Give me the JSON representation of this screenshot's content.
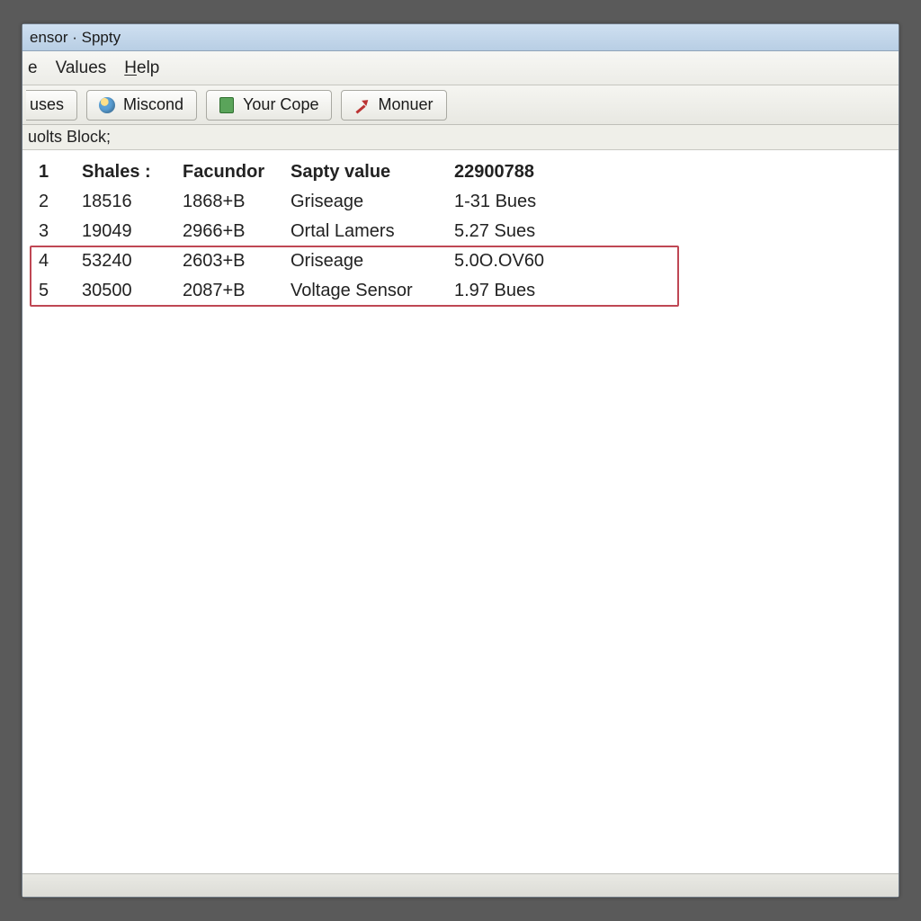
{
  "window": {
    "title": "ensor · Sppty"
  },
  "menubar": {
    "item0": "e",
    "item1": "Values",
    "item2_prefix": "H",
    "item2_rest": "elp"
  },
  "toolbar": {
    "btn0": "uses",
    "btn1": "Miscond",
    "btn2": "Your Cope",
    "btn3": "Monuer"
  },
  "subbar": {
    "text": "uolts Block;"
  },
  "table": {
    "header": {
      "c0": "1",
      "c1": "Shales :",
      "c2": "Facundor",
      "c3": "Sapty value",
      "c4": "22900788"
    },
    "rows": [
      {
        "c0": "2",
        "c1": "18516",
        "c2": "1868+B",
        "c3": "Griseage",
        "c4": "1-31 Bues"
      },
      {
        "c0": "3",
        "c1": "19049",
        "c2": "2966+B",
        "c3": "Ortal Lamers",
        "c4": "5.27 Sues"
      },
      {
        "c0": "4",
        "c1": "53240",
        "c2": "2603+B",
        "c3": "Oriseage",
        "c4": "5.0O.OV60"
      },
      {
        "c0": "5",
        "c1": "30500",
        "c2": "2087+B",
        "c3": "Voltage Sensor",
        "c4": "1.97 Bues"
      }
    ]
  }
}
